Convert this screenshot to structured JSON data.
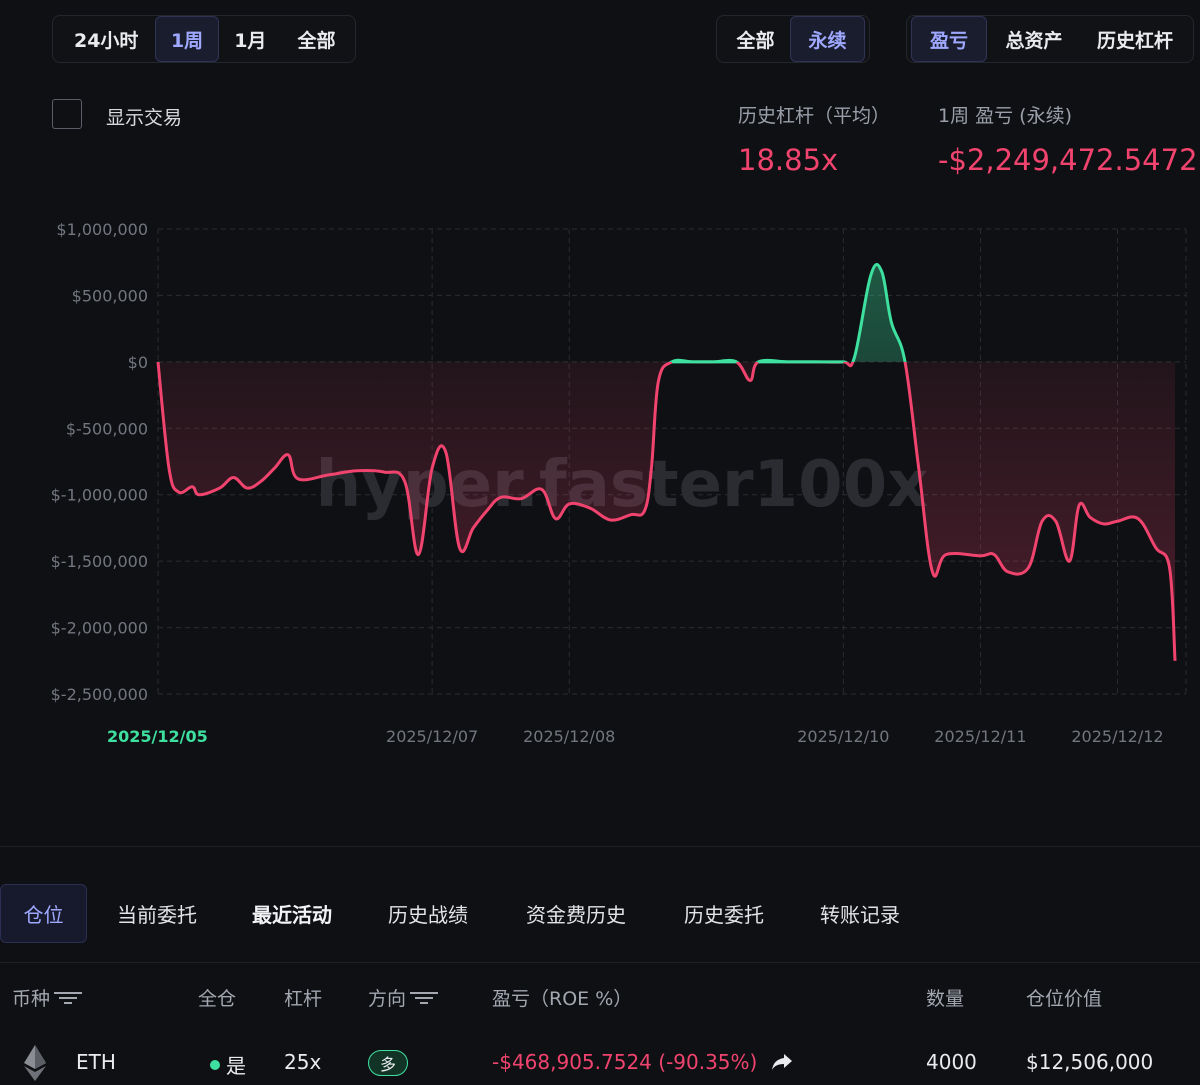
{
  "range_tabs": [
    "24小时",
    "1周",
    "1月",
    "全部"
  ],
  "range_active": 1,
  "market_tabs": [
    "全部",
    "永续"
  ],
  "market_active": 1,
  "metric_tabs": [
    "盈亏",
    "总资产",
    "历史杠杆"
  ],
  "metric_active": 0,
  "show_trades_label": "显示交易",
  "stats": {
    "leverage_label": "历史杠杆（平均）",
    "leverage_value": "18.85x",
    "pnl_label": "1周 盈亏 (永续)",
    "pnl_value": "-$2,249,472.5472"
  },
  "chart_data": {
    "type": "area",
    "watermark": "hyper.faster100x",
    "y_ticks": [
      "$1,000,000",
      "$500,000",
      "$0",
      "$-500,000",
      "$-1,000,000",
      "$-1,500,000",
      "$-2,000,000",
      "$-2,500,000"
    ],
    "y_tick_values": [
      1000000,
      500000,
      0,
      -500000,
      -1000000,
      -1500000,
      -2000000,
      -2500000
    ],
    "ylim": [
      -2500000,
      1000000
    ],
    "x_tick_labels": [
      "2025/12/05",
      "2025/12/07",
      "2025/12/08",
      "2025/12/10",
      "2025/12/11",
      "2025/12/12"
    ],
    "x_tick_days": [
      5.0,
      7.0,
      8.0,
      10.0,
      11.0,
      12.0
    ],
    "x_highlight_label": "2025/12/05",
    "xlim": [
      5.0,
      12.5
    ],
    "grid": true,
    "colors": {
      "positive": "#3ee0a0",
      "negative": "#f0446f",
      "grid": "#2a2c31"
    },
    "points": [
      [
        5.0,
        0
      ],
      [
        5.08,
        -800000
      ],
      [
        5.15,
        -980000
      ],
      [
        5.25,
        -940000
      ],
      [
        5.3,
        -1000000
      ],
      [
        5.45,
        -950000
      ],
      [
        5.55,
        -870000
      ],
      [
        5.65,
        -950000
      ],
      [
        5.75,
        -900000
      ],
      [
        5.85,
        -800000
      ],
      [
        5.95,
        -700000
      ],
      [
        6.02,
        -880000
      ],
      [
        6.25,
        -850000
      ],
      [
        6.45,
        -820000
      ],
      [
        6.65,
        -830000
      ],
      [
        6.8,
        -900000
      ],
      [
        6.9,
        -1450000
      ],
      [
        7.0,
        -800000
      ],
      [
        7.1,
        -680000
      ],
      [
        7.2,
        -1400000
      ],
      [
        7.3,
        -1250000
      ],
      [
        7.4,
        -1120000
      ],
      [
        7.5,
        -1020000
      ],
      [
        7.65,
        -1030000
      ],
      [
        7.8,
        -960000
      ],
      [
        7.9,
        -1180000
      ],
      [
        8.0,
        -1070000
      ],
      [
        8.15,
        -1100000
      ],
      [
        8.3,
        -1190000
      ],
      [
        8.45,
        -1150000
      ],
      [
        8.55,
        -1120000
      ],
      [
        8.6,
        -800000
      ],
      [
        8.65,
        -150000
      ],
      [
        8.75,
        0
      ],
      [
        8.9,
        0
      ],
      [
        9.05,
        0
      ],
      [
        9.22,
        0
      ],
      [
        9.32,
        -140000
      ],
      [
        9.38,
        0
      ],
      [
        9.6,
        0
      ],
      [
        9.8,
        0
      ],
      [
        10.0,
        0
      ],
      [
        10.08,
        30000
      ],
      [
        10.2,
        650000
      ],
      [
        10.28,
        680000
      ],
      [
        10.35,
        300000
      ],
      [
        10.45,
        0
      ],
      [
        10.55,
        -800000
      ],
      [
        10.65,
        -1580000
      ],
      [
        10.75,
        -1450000
      ],
      [
        11.0,
        -1460000
      ],
      [
        11.1,
        -1450000
      ],
      [
        11.2,
        -1580000
      ],
      [
        11.35,
        -1550000
      ],
      [
        11.45,
        -1200000
      ],
      [
        11.55,
        -1200000
      ],
      [
        11.65,
        -1500000
      ],
      [
        11.72,
        -1080000
      ],
      [
        11.8,
        -1170000
      ],
      [
        11.9,
        -1220000
      ],
      [
        12.0,
        -1200000
      ],
      [
        12.15,
        -1180000
      ],
      [
        12.28,
        -1400000
      ],
      [
        12.38,
        -1550000
      ],
      [
        12.42,
        -2250000
      ]
    ]
  },
  "bottom_tabs": [
    "仓位",
    "当前委托",
    "最近活动",
    "历史战绩",
    "资金费历史",
    "历史委托",
    "转账记录"
  ],
  "bottom_active": 0,
  "table": {
    "headers": [
      "币种",
      "全仓",
      "杠杆",
      "方向",
      "盈亏（ROE %）",
      "数量",
      "仓位价值"
    ],
    "row": {
      "coin": "ETH",
      "cross": "是",
      "leverage": "25x",
      "side": "多",
      "pnl": "-$468,905.7524 (-90.35%)",
      "size": "4000",
      "value": "$12,506,000"
    }
  }
}
